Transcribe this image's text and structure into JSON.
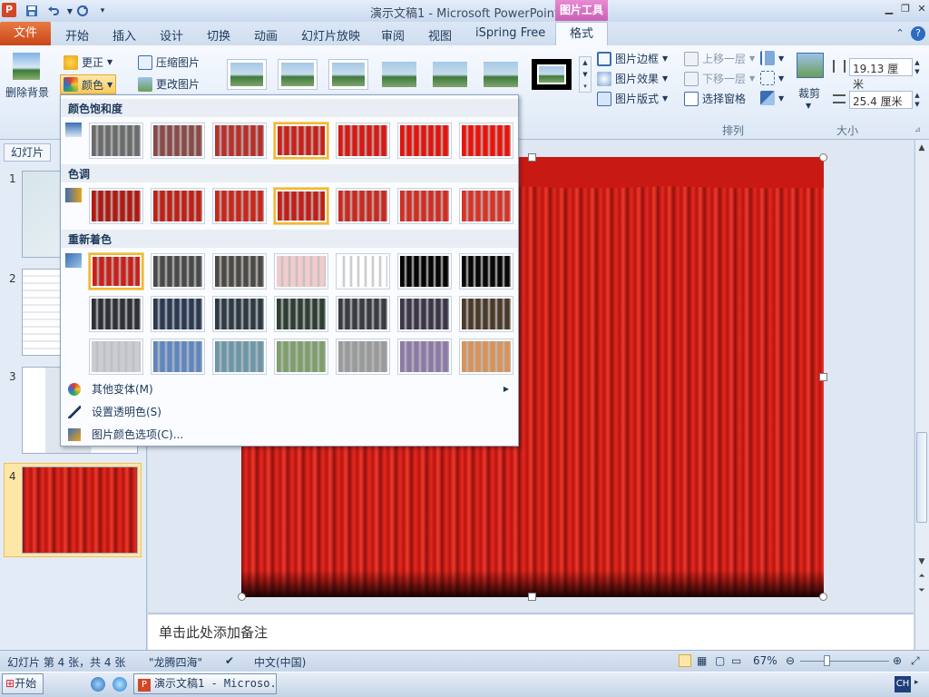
{
  "app": {
    "title": "演示文稿1 - Microsoft PowerPoint",
    "context_tab_group": "图片工具"
  },
  "qat": {
    "save": "save-icon",
    "undo": "undo-icon",
    "redo": "redo-icon"
  },
  "tabs": {
    "file": "文件",
    "items": [
      "开始",
      "插入",
      "设计",
      "切换",
      "动画",
      "幻灯片放映",
      "审阅",
      "视图",
      "iSpring Free"
    ],
    "format": "格式"
  },
  "ribbon": {
    "remove_bg": "删除背景",
    "corrections": "更正",
    "color": "颜色",
    "compress": "压缩图片",
    "change_picture": "更改图片",
    "picture_border": "图片边框",
    "picture_effects": "图片效果",
    "picture_layout": "图片版式",
    "bring_forward": "上移一层",
    "send_backward": "下移一层",
    "selection_pane": "选择窗格",
    "arrange_label": "排列",
    "crop": "裁剪",
    "height": "19.13 厘米",
    "width": "25.4 厘米",
    "size_label": "大小"
  },
  "color_menu": {
    "saturation_header": "颜色饱和度",
    "tone_header": "色调",
    "recolor_header": "重新着色",
    "more_variations": "其他变体(M)",
    "set_transparent": "设置透明色(S)",
    "color_options": "图片颜色选项(C)...",
    "saturation_selected_index": 3,
    "tone_selected_index": 3,
    "recolor_selected_index": 0,
    "saturation": [
      "#6b6b6b",
      "#8a4a48",
      "#b8302a",
      "#c9211a",
      "#d61a14",
      "#e0150e",
      "#e8140c"
    ],
    "tone": [
      "#b01a12",
      "#c02015",
      "#c8271b",
      "#c02018",
      "#c92a20",
      "#d12d22",
      "#d83328"
    ],
    "recolor": [
      [
        "#c9211a",
        "#4a4a4a",
        "#4d4a45",
        "#f2cccc",
        "#ffffff",
        "#050505",
        "#080808"
      ],
      [
        "#2e3135",
        "#2b3a52",
        "#2e3a44",
        "#2f3f33",
        "#3b3c40",
        "#3c3648",
        "#4a3a28"
      ],
      [
        "#c9ccd0",
        "#5f86c0",
        "#6b97a8",
        "#7f9e6a",
        "#9a9a9a",
        "#8c7aa6",
        "#d7935a"
      ]
    ]
  },
  "left_panel": {
    "tab": "幻灯片",
    "slide_numbers": [
      "1",
      "2",
      "3",
      "4"
    ]
  },
  "notes": {
    "placeholder": "单击此处添加备注"
  },
  "status": {
    "slide_info": "幻灯片 第 4 张，共 4 张",
    "theme": "\"龙腾四海\"",
    "language": "中文(中国)",
    "zoom": "67%"
  },
  "taskbar": {
    "start": "开始",
    "item": "演示文稿1 - Microso...",
    "ime": "CH"
  }
}
